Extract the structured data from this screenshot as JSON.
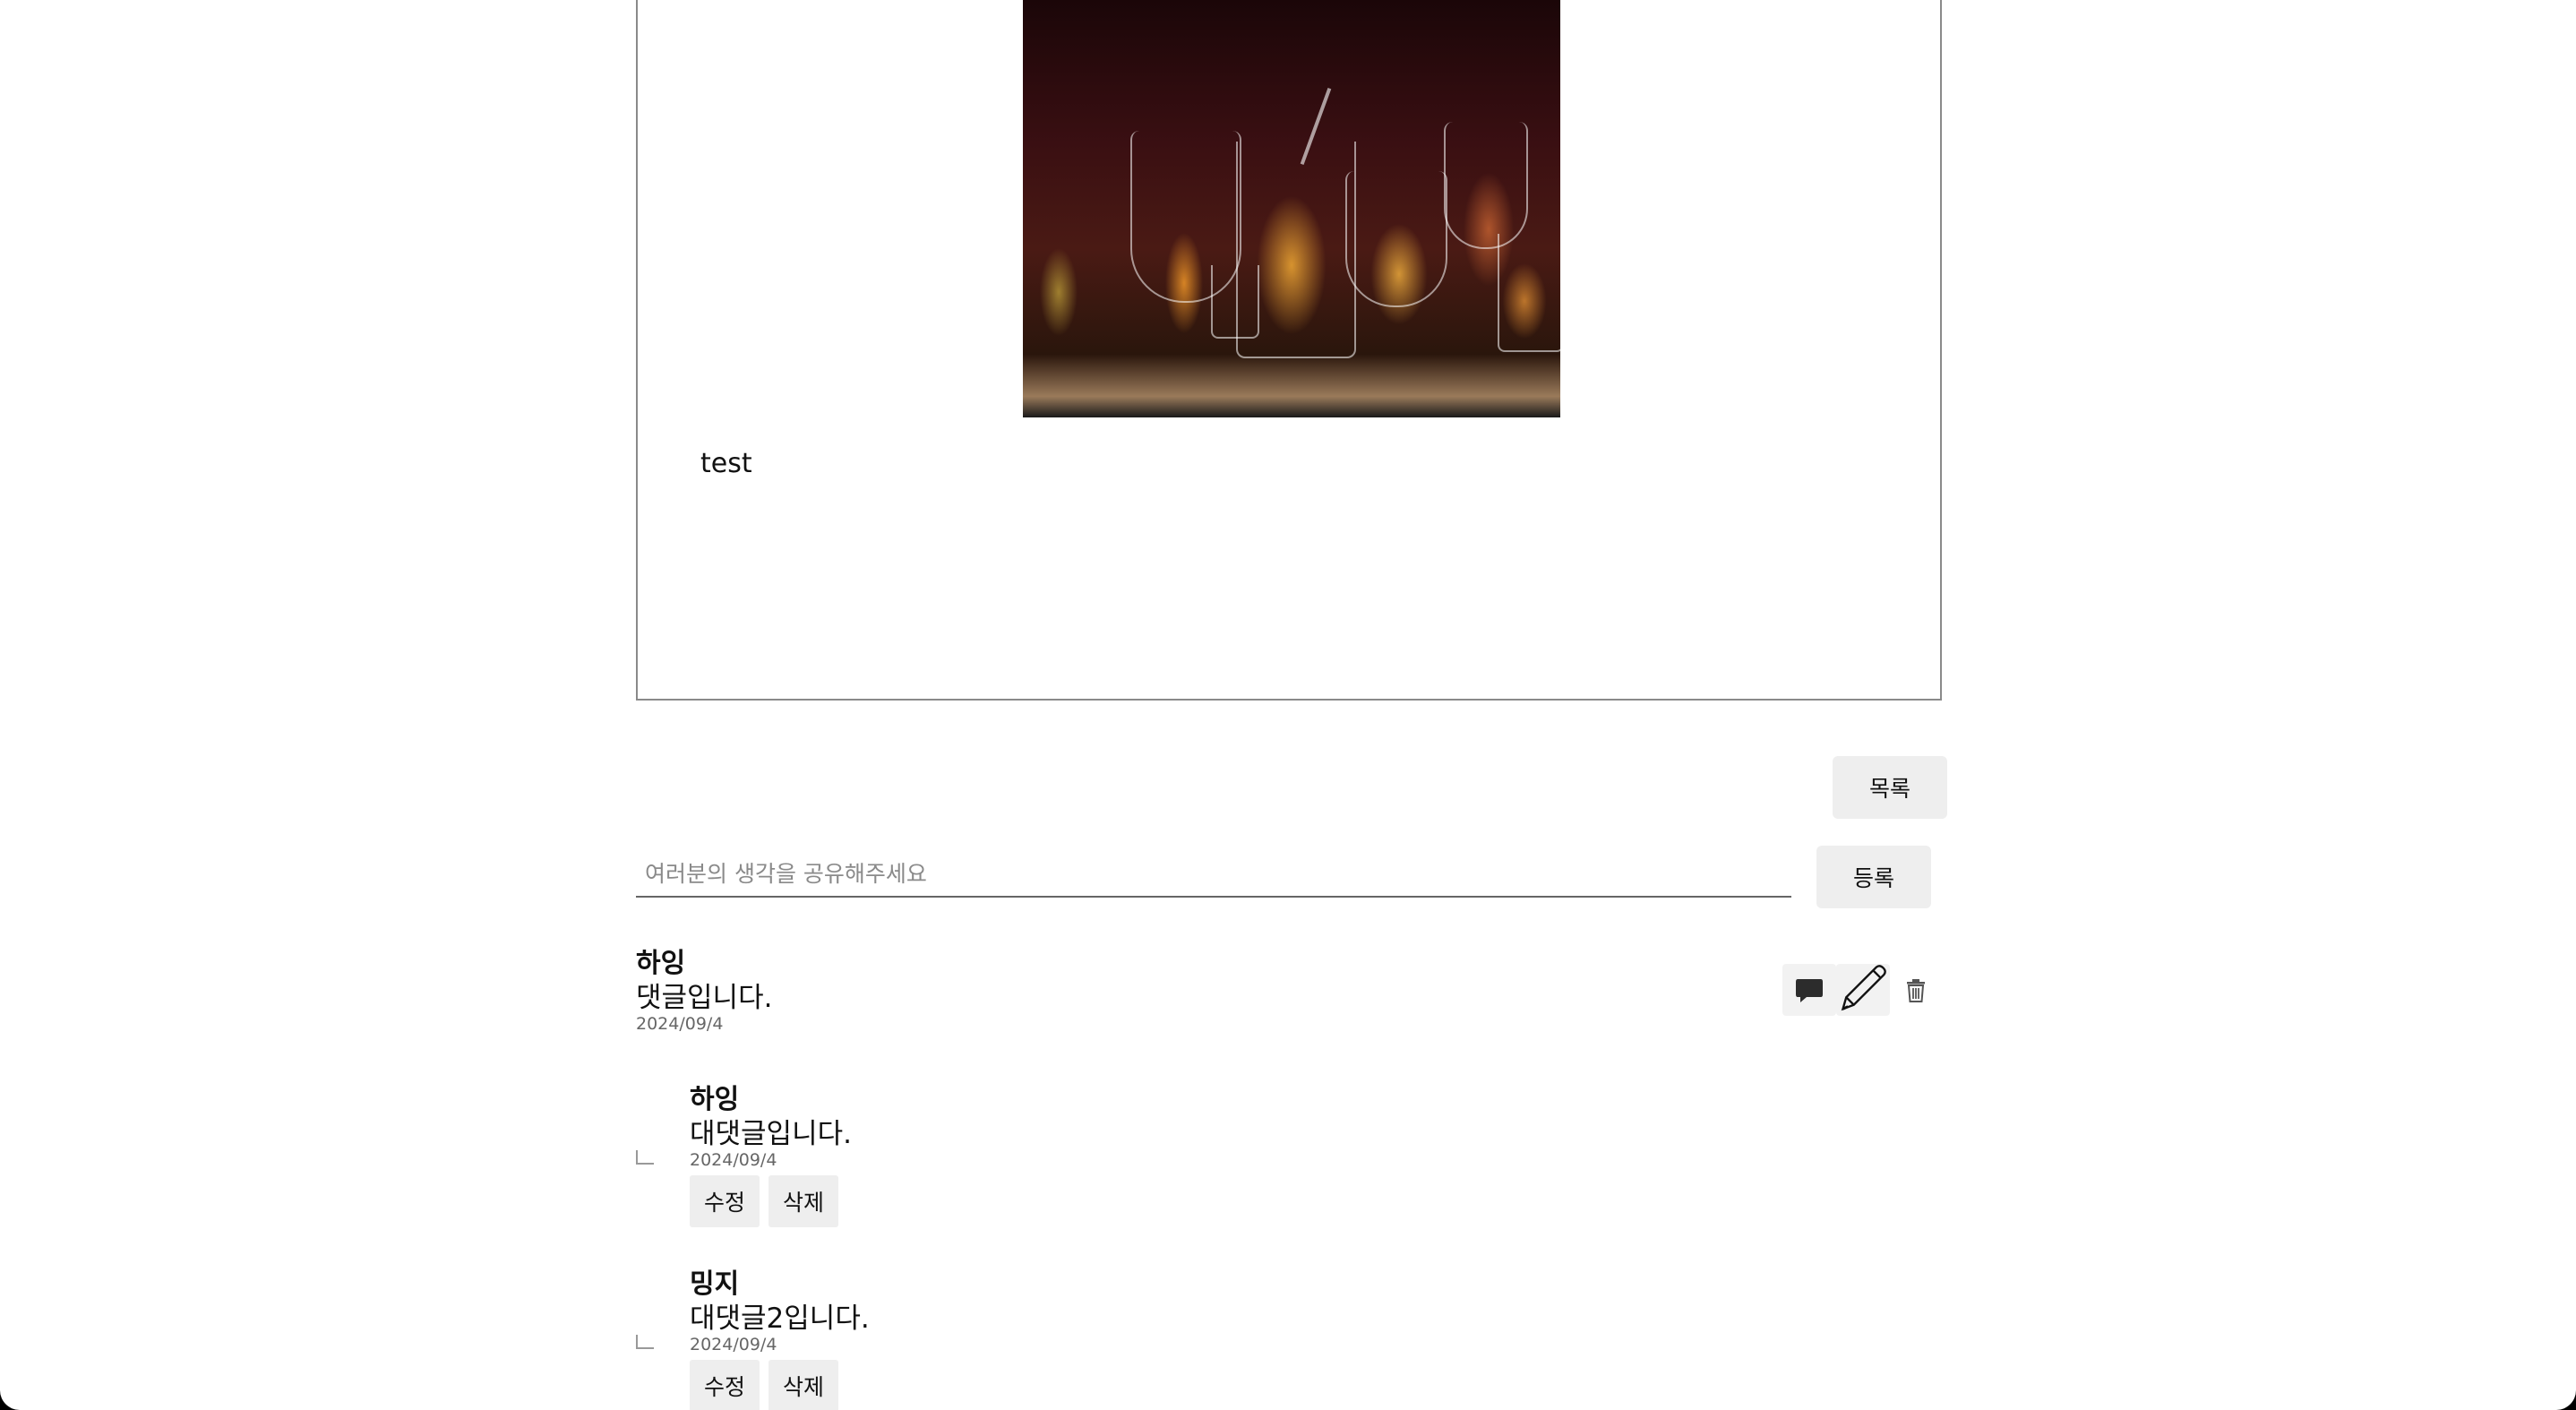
{
  "post": {
    "body_text": "test"
  },
  "actions": {
    "list_label": "목록",
    "register_label": "등록"
  },
  "comment_form": {
    "placeholder": "여러분의 생각을 공유해주세요",
    "value": ""
  },
  "comments": [
    {
      "author": "하잉",
      "text": "댓글입니다.",
      "date": "2024/09/4",
      "icons": [
        "speech-bubble-icon",
        "pencil-icon",
        "trash-icon"
      ]
    }
  ],
  "replies": [
    {
      "author": "하잉",
      "text": "대댓글입니다.",
      "date": "2024/09/4",
      "edit_label": "수정",
      "delete_label": "삭제"
    },
    {
      "author": "밍지",
      "text": "대댓글2입니다.",
      "date": "2024/09/4",
      "edit_label": "수정",
      "delete_label": "삭제"
    }
  ]
}
